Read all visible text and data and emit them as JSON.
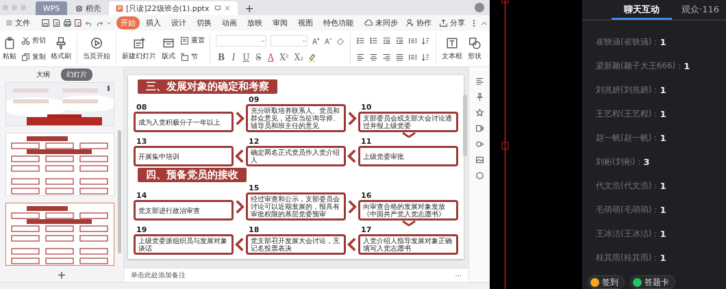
{
  "tabbar": {
    "tabs": [
      {
        "label": "WPS",
        "kind": "home",
        "selected": false
      },
      {
        "label": "稻壳",
        "kind": "docer",
        "selected": false
      },
      {
        "label": "[只读]22级班会(1).pptx",
        "kind": "doc",
        "selected": true
      }
    ],
    "new_tab": "+"
  },
  "menu": {
    "file": "文件",
    "tabs": [
      {
        "label": "开始",
        "selected": true
      },
      {
        "label": "插入",
        "selected": false
      },
      {
        "label": "设计",
        "selected": false
      },
      {
        "label": "切换",
        "selected": false
      },
      {
        "label": "动画",
        "selected": false
      },
      {
        "label": "放映",
        "selected": false
      },
      {
        "label": "审阅",
        "selected": false
      },
      {
        "label": "视图",
        "selected": false
      },
      {
        "label": "特色功能",
        "selected": false
      }
    ],
    "sync": "未同步",
    "collaborate": "协作",
    "share": "分享"
  },
  "ribbon": {
    "paste": "粘贴",
    "cut": "剪切",
    "copy": "复制",
    "format_painter": "格式刷",
    "play_from_current": "当页开始",
    "new_slide": "新建幻灯片",
    "layout": "版式",
    "reset": "重置",
    "section": "节",
    "format_glyphs": [
      "B",
      "I",
      "U",
      "S",
      "A",
      "X²",
      "X₂"
    ],
    "text_box": "文本框",
    "shape": "形状"
  },
  "left_panel": {
    "view_tabs": [
      {
        "label": "大纲",
        "selected": false
      },
      {
        "label": "幻灯片",
        "selected": true
      }
    ],
    "thumbnails": [
      {
        "kind": "cover",
        "selected": false
      },
      {
        "kind": "flow",
        "selected": false
      },
      {
        "kind": "flow",
        "selected": true
      }
    ],
    "add": "+"
  },
  "slide": {
    "sections": [
      {
        "title": "三、发展对象的确定和考察",
        "rows": [
          {
            "steps": [
              {
                "number": "08",
                "text": "成为入党积极分子一年以上"
              },
              {
                "number": "09",
                "text": "充分听取培养联系人、党员和群众意见，还应当征询导师、辅导员和班主任的意见"
              },
              {
                "number": "10",
                "text": "支部委员会或支部大会讨论通过并报上级党委"
              }
            ]
          },
          {
            "steps": [
              {
                "number": "13",
                "text": "开展集中培训"
              },
              {
                "number": "12",
                "text": "确定两名正式党员作入党介绍人"
              },
              {
                "number": "11",
                "text": "上级党委审批"
              }
            ]
          }
        ]
      },
      {
        "title": "四、预备党员的接收",
        "rows": [
          {
            "steps": [
              {
                "number": "14",
                "text": "党支部进行政治审查"
              },
              {
                "number": "15",
                "text": "经过审查和公示，支部委员会讨论可以近期发展的，报具有审批权限的基层党委预审"
              },
              {
                "number": "16",
                "text": "向审查合格的发展对象发放《中国共产党入党志愿书》"
              }
            ]
          },
          {
            "steps": [
              {
                "number": "19",
                "text": "上级党委派组织员与发展对象谈话"
              },
              {
                "number": "18",
                "text": "党支部召开发展大会讨论，无记名投票表决"
              },
              {
                "number": "17",
                "text": "入党介绍人指导发展对象正确填写入党志愿书"
              }
            ]
          }
        ]
      }
    ]
  },
  "notes": {
    "placeholder": "单击此处添加备注",
    "more": "···"
  },
  "chat": {
    "tabs": [
      {
        "label": "聊天互动",
        "selected": true
      },
      {
        "label": "观众·116",
        "selected": false
      }
    ],
    "messages": [
      {
        "name": "崔轶涵(崔轶涵)：",
        "text": "1"
      },
      {
        "name": "梁新颖(颖子大王666)：",
        "text": "1"
      },
      {
        "name": "刘兆妍(刘兆妍)：",
        "text": "1"
      },
      {
        "name": "王艺程(王艺程)：",
        "text": "1"
      },
      {
        "name": "赵一帆(赵一帆)：",
        "text": "1"
      },
      {
        "name": "刘彬(刘彬)：",
        "text": "3"
      },
      {
        "name": "代文浩(代文浩)：",
        "text": "1"
      },
      {
        "name": "毛萌萌(毛萌萌)：",
        "text": "1"
      },
      {
        "name": "王冰洁(王冰洁)：",
        "text": "1"
      },
      {
        "name": "桂其雨(桂其雨)：",
        "text": "1"
      }
    ],
    "buttons": [
      {
        "label": "签到",
        "color": "#f5a623"
      },
      {
        "label": "答题卡",
        "color": "#22c55e"
      }
    ]
  }
}
